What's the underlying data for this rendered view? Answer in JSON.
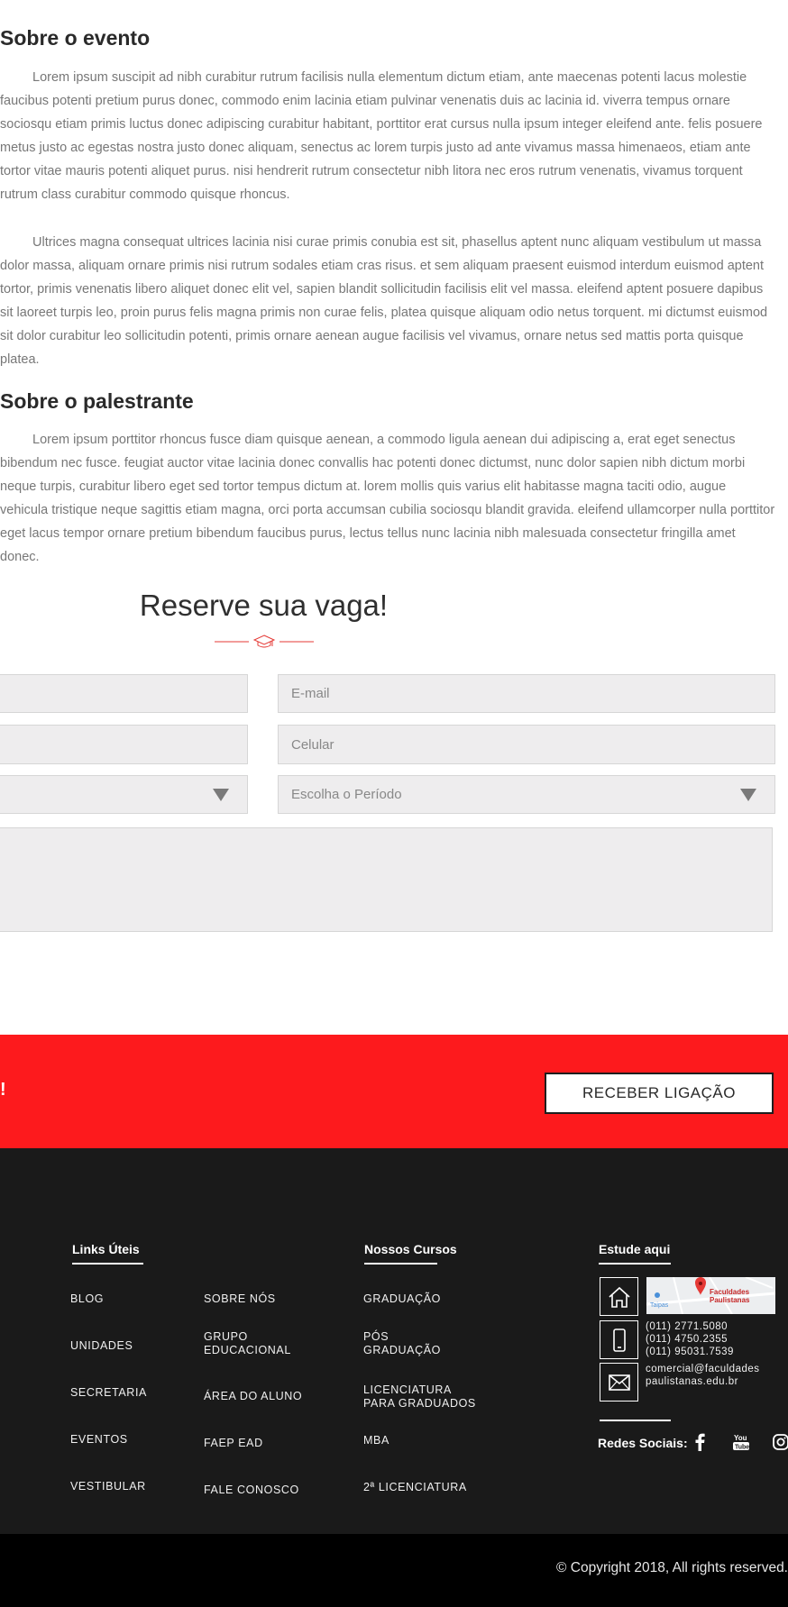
{
  "about_event": {
    "title": "Sobre o evento",
    "p1": "Lorem ipsum suscipit ad nibh curabitur rutrum facilisis nulla elementum dictum etiam, ante maecenas potenti lacus molestie faucibus potenti pretium purus donec, commodo enim lacinia etiam pulvinar venenatis duis ac lacinia id. viverra tempus ornare sociosqu etiam primis luctus donec adipiscing curabitur habitant, porttitor erat cursus nulla ipsum integer eleifend ante. felis posuere metus justo ac egestas nostra justo donec aliquam, senectus ac lorem turpis justo ad ante vivamus massa himenaeos, etiam ante tortor vitae mauris potenti aliquet purus. nisi hendrerit rutrum consectetur nibh litora nec eros rutrum venenatis, vivamus torquent rutrum class curabitur commodo quisque rhoncus.",
    "p2": "Ultrices magna consequat ultrices lacinia nisi curae primis conubia est sit, phasellus aptent nunc aliquam vestibulum ut massa dolor massa, aliquam ornare primis nisi rutrum sodales etiam cras risus. et sem aliquam praesent euismod interdum euismod aptent tortor, primis venenatis libero aliquet donec elit vel, sapien blandit sollicitudin facilisis elit vel massa. eleifend aptent posuere dapibus sit laoreet turpis leo, proin purus felis magna primis non curae felis, platea quisque aliquam odio netus torquent. mi dictumst euismod sit dolor curabitur leo sollicitudin potenti, primis ornare aenean augue facilisis vel vivamus, ornare netus sed mattis porta quisque platea."
  },
  "about_speaker": {
    "title": "Sobre o palestrante",
    "p1": "Lorem ipsum porttitor rhoncus fusce diam quisque aenean, a commodo ligula aenean dui adipiscing a, erat eget senectus bibendum nec fusce. feugiat auctor vitae lacinia donec convallis hac potenti donec dictumst, nunc dolor sapien nibh dictum morbi neque turpis, curabitur libero eget sed tortor tempus dictum at. lorem mollis quis varius elit habitasse magna taciti odio, augue vehicula tristique neque sagittis etiam magna, orci porta accumsan cubilia sociosqu blandit gravida. eleifend ullamcorper nulla porttitor eget lacus tempor ornare pretium bibendum faucibus purus, lectus tellus nunc lacinia nibh malesuada consectetur fringilla amet donec."
  },
  "form": {
    "title": "Reserve sua vaga!",
    "email_placeholder": "E-mail",
    "phone_placeholder": "Celular",
    "period_placeholder": "Escolha o Período"
  },
  "cta": {
    "mark": "!",
    "button": "RECEBER LIGAÇÃO"
  },
  "footer": {
    "links_title": "Links Úteis",
    "links_col1": [
      "BLOG",
      "UNIDADES",
      "SECRETARIA",
      "EVENTOS",
      "VESTIBULAR"
    ],
    "links_col2": [
      "SOBRE NÓS",
      "GRUPO EDUCACIONAL",
      "ÁREA DO ALUNO",
      "FAEP EAD",
      "FALE CONOSCO"
    ],
    "courses_title": "Nossos Cursos",
    "courses": [
      "GRADUAÇÃO",
      "PÓS GRADUAÇÃO",
      "LICENCIATURA PARA GRADUADOS",
      "MBA",
      "2ª LICENCIATURA"
    ],
    "study_title": "Estude aqui",
    "map_label": "Faculdades Paulistanas",
    "map_place": "Taipas",
    "phones": [
      "(011) 2771.5080",
      "(011) 4750.2355",
      "(011) 95031.7539"
    ],
    "email": "comercial@faculdadespaulistanas.edu.br",
    "social_label": "Redes Sociais:",
    "social_icons": [
      "facebook-icon",
      "youtube-icon",
      "instagram-icon"
    ]
  },
  "copyright": "© Copyright 2018, All rights reserved.",
  "colors": {
    "accent_red": "#fd1a1d",
    "footer_bg": "#1a1a1a",
    "bottom_bg": "#000000",
    "text_gray": "#777777"
  }
}
